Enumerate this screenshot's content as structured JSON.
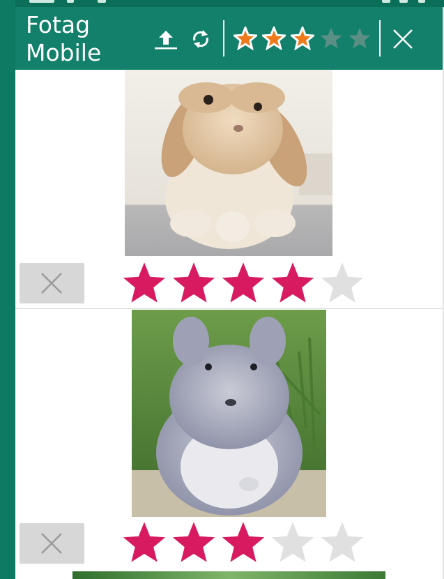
{
  "app_bar": {
    "title": "Fotag\nMobile",
    "icons": [
      "upload-icon",
      "refresh-icon",
      "close-icon"
    ],
    "filter_rating": 3,
    "filter_max": 5,
    "colors": {
      "bar": "#12806a",
      "star_on": "#f07a1a",
      "star_outline": "#ffffff",
      "star_off": "#5b8f86"
    }
  },
  "images": [
    {
      "subject": "rabbit",
      "rating": 4,
      "max": 5
    },
    {
      "subject": "chinchilla",
      "rating": 3,
      "max": 5
    },
    {
      "subject": "partial-image",
      "rating": null,
      "max": 5
    }
  ],
  "colors": {
    "rating_on": "#d81b60",
    "rating_off": "#e0e0e0",
    "remove_button_bg": "#d7d7d7",
    "remove_icon": "#9a9a9a"
  }
}
